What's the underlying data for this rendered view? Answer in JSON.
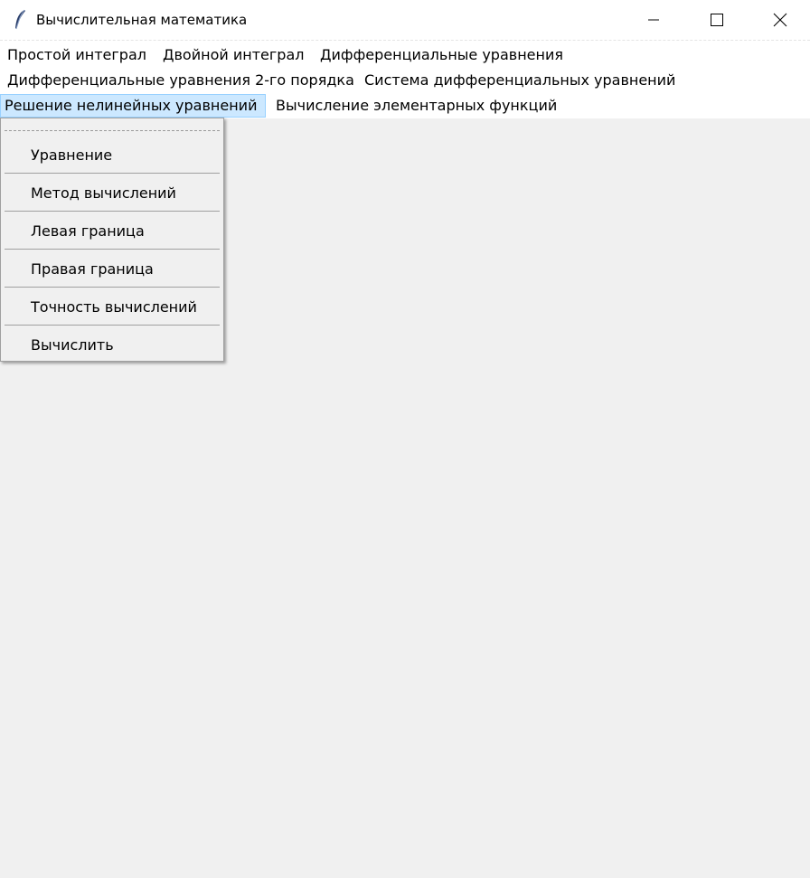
{
  "window": {
    "title": "Вычислительная математика",
    "app_icon": "feather-icon",
    "controls": [
      "minimize-icon",
      "maximize-icon",
      "close-icon"
    ]
  },
  "menubar": {
    "items": [
      {
        "label": "Простой интеграл"
      },
      {
        "label": "Двойной интеграл"
      },
      {
        "label": "Дифференциальные уравнения"
      },
      {
        "label": "Дифференциальные уравнения 2-го порядка"
      },
      {
        "label": "Система дифференциальных уравнений"
      },
      {
        "label": "Решение нелинейных уравнений",
        "active": true
      },
      {
        "label": "Вычисление элементарных функций"
      }
    ]
  },
  "dropdown": {
    "items": [
      {
        "label": "Уравнение"
      },
      {
        "label": "Метод вычислений"
      },
      {
        "label": "Левая граница"
      },
      {
        "label": "Правая граница"
      },
      {
        "label": "Точность вычислений"
      },
      {
        "label": "Вычислить"
      }
    ]
  },
  "colors": {
    "background": "#f0f0f0",
    "titlebar": "#ffffff",
    "active_menu_bg": "#cce8ff",
    "active_menu_border": "#99d1ff"
  }
}
